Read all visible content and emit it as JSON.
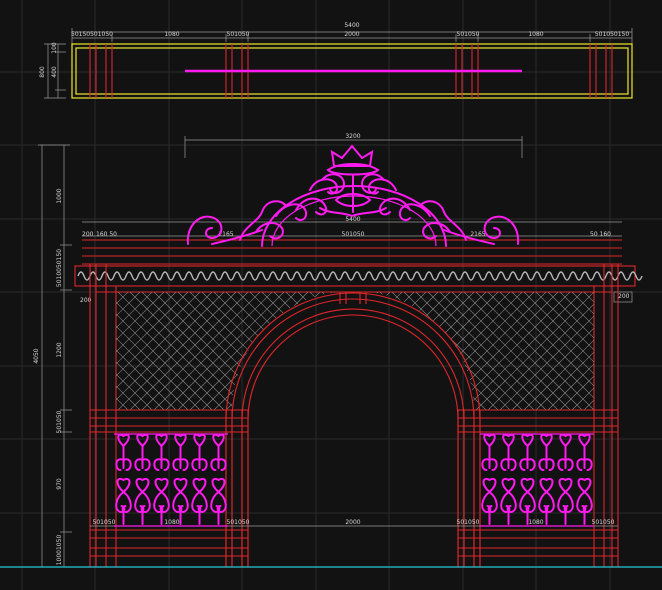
{
  "dimensions": {
    "plan_overall": "5400",
    "plan_seg_left": "50150501050",
    "plan_1080_left": "1080",
    "plan_mid_left": "501050",
    "plan_2000": "2000",
    "plan_mid_right": "501050",
    "plan_1080_right": "1080",
    "plan_seg_right": "501050150",
    "plan_side_800": "800",
    "plan_side_100": "100",
    "plan_side_400": "400",
    "crown_3200": "3200",
    "arch_5400": "5400",
    "span_2165_left": "2165",
    "span_2165_right": "2165",
    "left_200": "200",
    "left_160_50": "160 50",
    "center_501050": "501050",
    "right_50_160": "50 160",
    "beam_stack": "5010050150",
    "beam_200_left": "200",
    "beam_200_right": "200",
    "height_total": "4050",
    "height_1000": "1000",
    "height_1200": "1200",
    "height_501050": "501050",
    "height_970": "970",
    "height_bottom": "10001050",
    "bottom_left_501050": "501050",
    "bottom_1080_left": "1080",
    "bottom_mid_left": "501050",
    "bottom_2000": "2000",
    "bottom_mid_right": "501050",
    "bottom_1080_right": "1080",
    "bottom_right_501050": "501050"
  },
  "colors": {
    "background": "#121212",
    "frame": "#e0262b",
    "ornament": "#ff1bf0",
    "plan_outline": "#f0e628",
    "dimension": "#9a9a9a",
    "ground": "#27c8d8"
  }
}
